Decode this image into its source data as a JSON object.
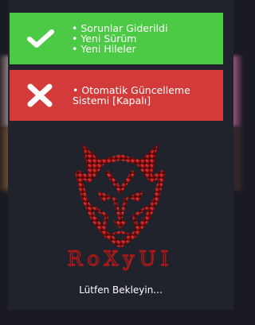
{
  "notices": {
    "success": {
      "icon": "checkmark-icon",
      "color": "#4dca45",
      "items": [
        "• Sorunlar Giderildi",
        "• Yeni Sürüm",
        "• Yeni Hileler"
      ]
    },
    "error": {
      "icon": "cross-icon",
      "color": "#d23b39",
      "text": "• Otomatik Güncelleme Sistemi [Kapalı]"
    }
  },
  "logo": {
    "text": "RoXyUI",
    "icon": "wolf-head-logo",
    "color": "#b01818"
  },
  "status": {
    "text": "Lütfen Bekleyin..."
  }
}
